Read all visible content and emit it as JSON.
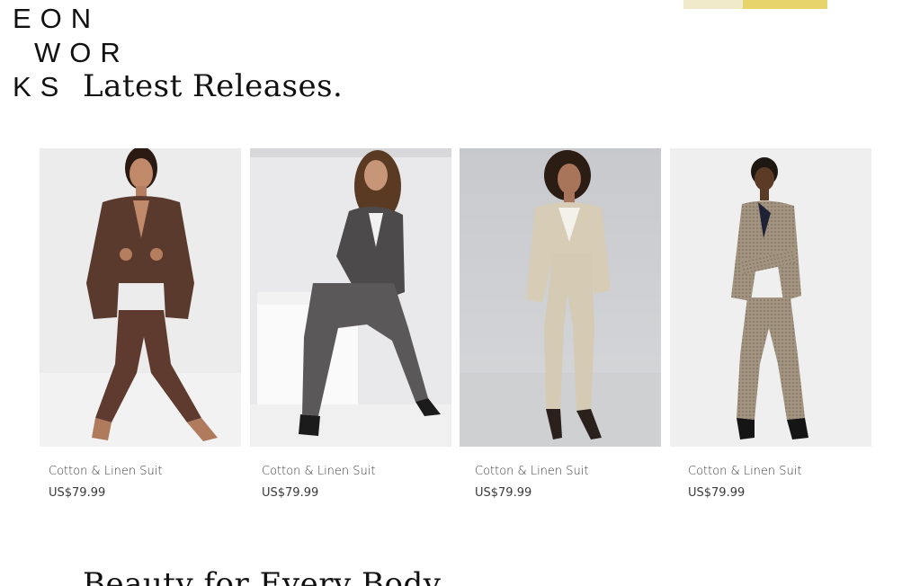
{
  "brand": {
    "logo_line1": "EON",
    "logo_line2": "WOR",
    "logo_line3": "KS"
  },
  "accent_colors": [
    "#f0eaca",
    "#e7d46a"
  ],
  "latest": {
    "title": "Latest Releases.",
    "products": [
      {
        "name": "Cotton & Linen Suit",
        "price": "US$79.99",
        "image": "brown-suit-photo"
      },
      {
        "name": "Cotton & Linen Suit",
        "price": "US$79.99",
        "image": "grey-suit-photo"
      },
      {
        "name": "Cotton & Linen Suit",
        "price": "US$79.99",
        "image": "beige-suit-photo"
      },
      {
        "name": "Cotton & Linen Suit",
        "price": "US$79.99",
        "image": "checked-suit-photo"
      }
    ]
  },
  "next_section": {
    "title": "Beauty for Every Body"
  }
}
